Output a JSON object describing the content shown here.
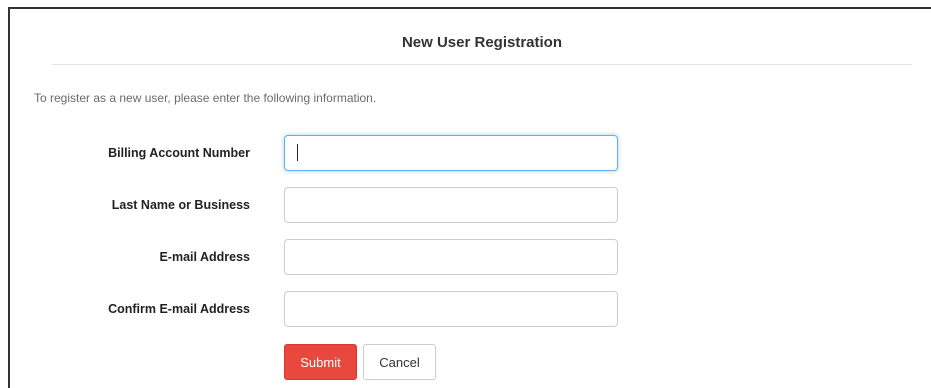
{
  "form": {
    "title": "New User Registration",
    "intro": "To register as a new user, please enter the following information.",
    "fields": [
      {
        "label": "Billing Account Number",
        "value": "",
        "placeholder": "",
        "focused": true
      },
      {
        "label": "Last Name or Business",
        "value": "",
        "placeholder": ""
      },
      {
        "label": "E-mail Address",
        "value": "",
        "placeholder": ""
      },
      {
        "label": "Confirm E-mail Address",
        "value": "",
        "placeholder": ""
      }
    ],
    "submit_label": "Submit",
    "cancel_label": "Cancel"
  },
  "colors": {
    "submit_bg": "#e8483d",
    "focus_border": "#66afe9"
  }
}
